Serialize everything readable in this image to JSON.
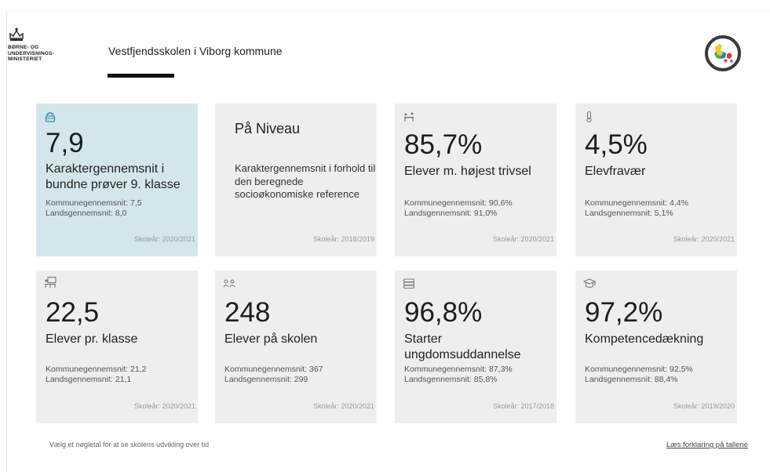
{
  "header": {
    "ministry_logo_text": "BØRNE- OG\nUNDERVISNINGS-\nMINISTERIET",
    "school_title": "Vestfjendsskolen i Viborg kommune",
    "map_badge_icon": "denmark-map-icon"
  },
  "cards": [
    {
      "icon": "lock-icon",
      "value": "7,9",
      "label": "Karaktergennemsnit i bundne prøver 9. klasse",
      "sub1": "Kommunegennemsnit: 7,5",
      "sub2": "Landsgennemsnit: 8,0",
      "year": "Skoleår: 2020/2021",
      "selected": true
    },
    {
      "head": "På Niveau",
      "desc": "Karaktergennemsnit i forhold til den beregnede socioøkonomiske reference",
      "year": "Skoleår: 2018/2019"
    },
    {
      "icon": "students-desk-icon",
      "value": "85,7%",
      "label": "Elever m. højest trivsel",
      "sub1": "Kommunegennemsnit: 90,6%",
      "sub2": "Landsgennemsnit: 91,0%",
      "year": "Skoleår: 2020/2021"
    },
    {
      "icon": "thermometer-icon",
      "value": "4,5%",
      "label": "Elevfravær",
      "sub1": "Kommunegennemsnit: 4,4%",
      "sub2": "Landsgennemsnit: 5,1%",
      "year": "Skoleår: 2020/2021"
    },
    {
      "icon": "classroom-icon",
      "value": "22,5",
      "label": "Elever pr. klasse",
      "sub1": "Kommunegennemsnit: 21,2",
      "sub2": "Landsgennemsnit: 21,1",
      "year": "Skoleår: 2020/2021"
    },
    {
      "icon": "group-icon",
      "value": "248",
      "label": "Elever på skolen",
      "sub1": "Kommunegennemsnit: 367",
      "sub2": "Landsgennemsnit: 299",
      "year": "Skoleår: 2020/2021"
    },
    {
      "icon": "books-icon",
      "value": "96,8%",
      "label": "Starter ungdomsuddannelse",
      "sub1": "Kommunegennemsnit: 87,3%",
      "sub2": "Landsgennemsnit: 85,8%",
      "year": "Skoleår: 2017/2018"
    },
    {
      "icon": "graduation-cap-icon",
      "value": "97,2%",
      "label": "Kompetencedækning",
      "sub1": "Kommunegennemsnit: 92,5%",
      "sub2": "Landsgennemsnit: 88,4%",
      "year": "Skoleår: 2019/2020"
    }
  ],
  "footer": {
    "hint": "Vælg et nøgletal for at se skolens udvikling over tid",
    "explain_link": "Læs forklaring på tallene"
  },
  "colors": {
    "selected_card": "#d3e6ec",
    "card": "#eeeeee",
    "accent_icon": "#2a8fb5"
  }
}
